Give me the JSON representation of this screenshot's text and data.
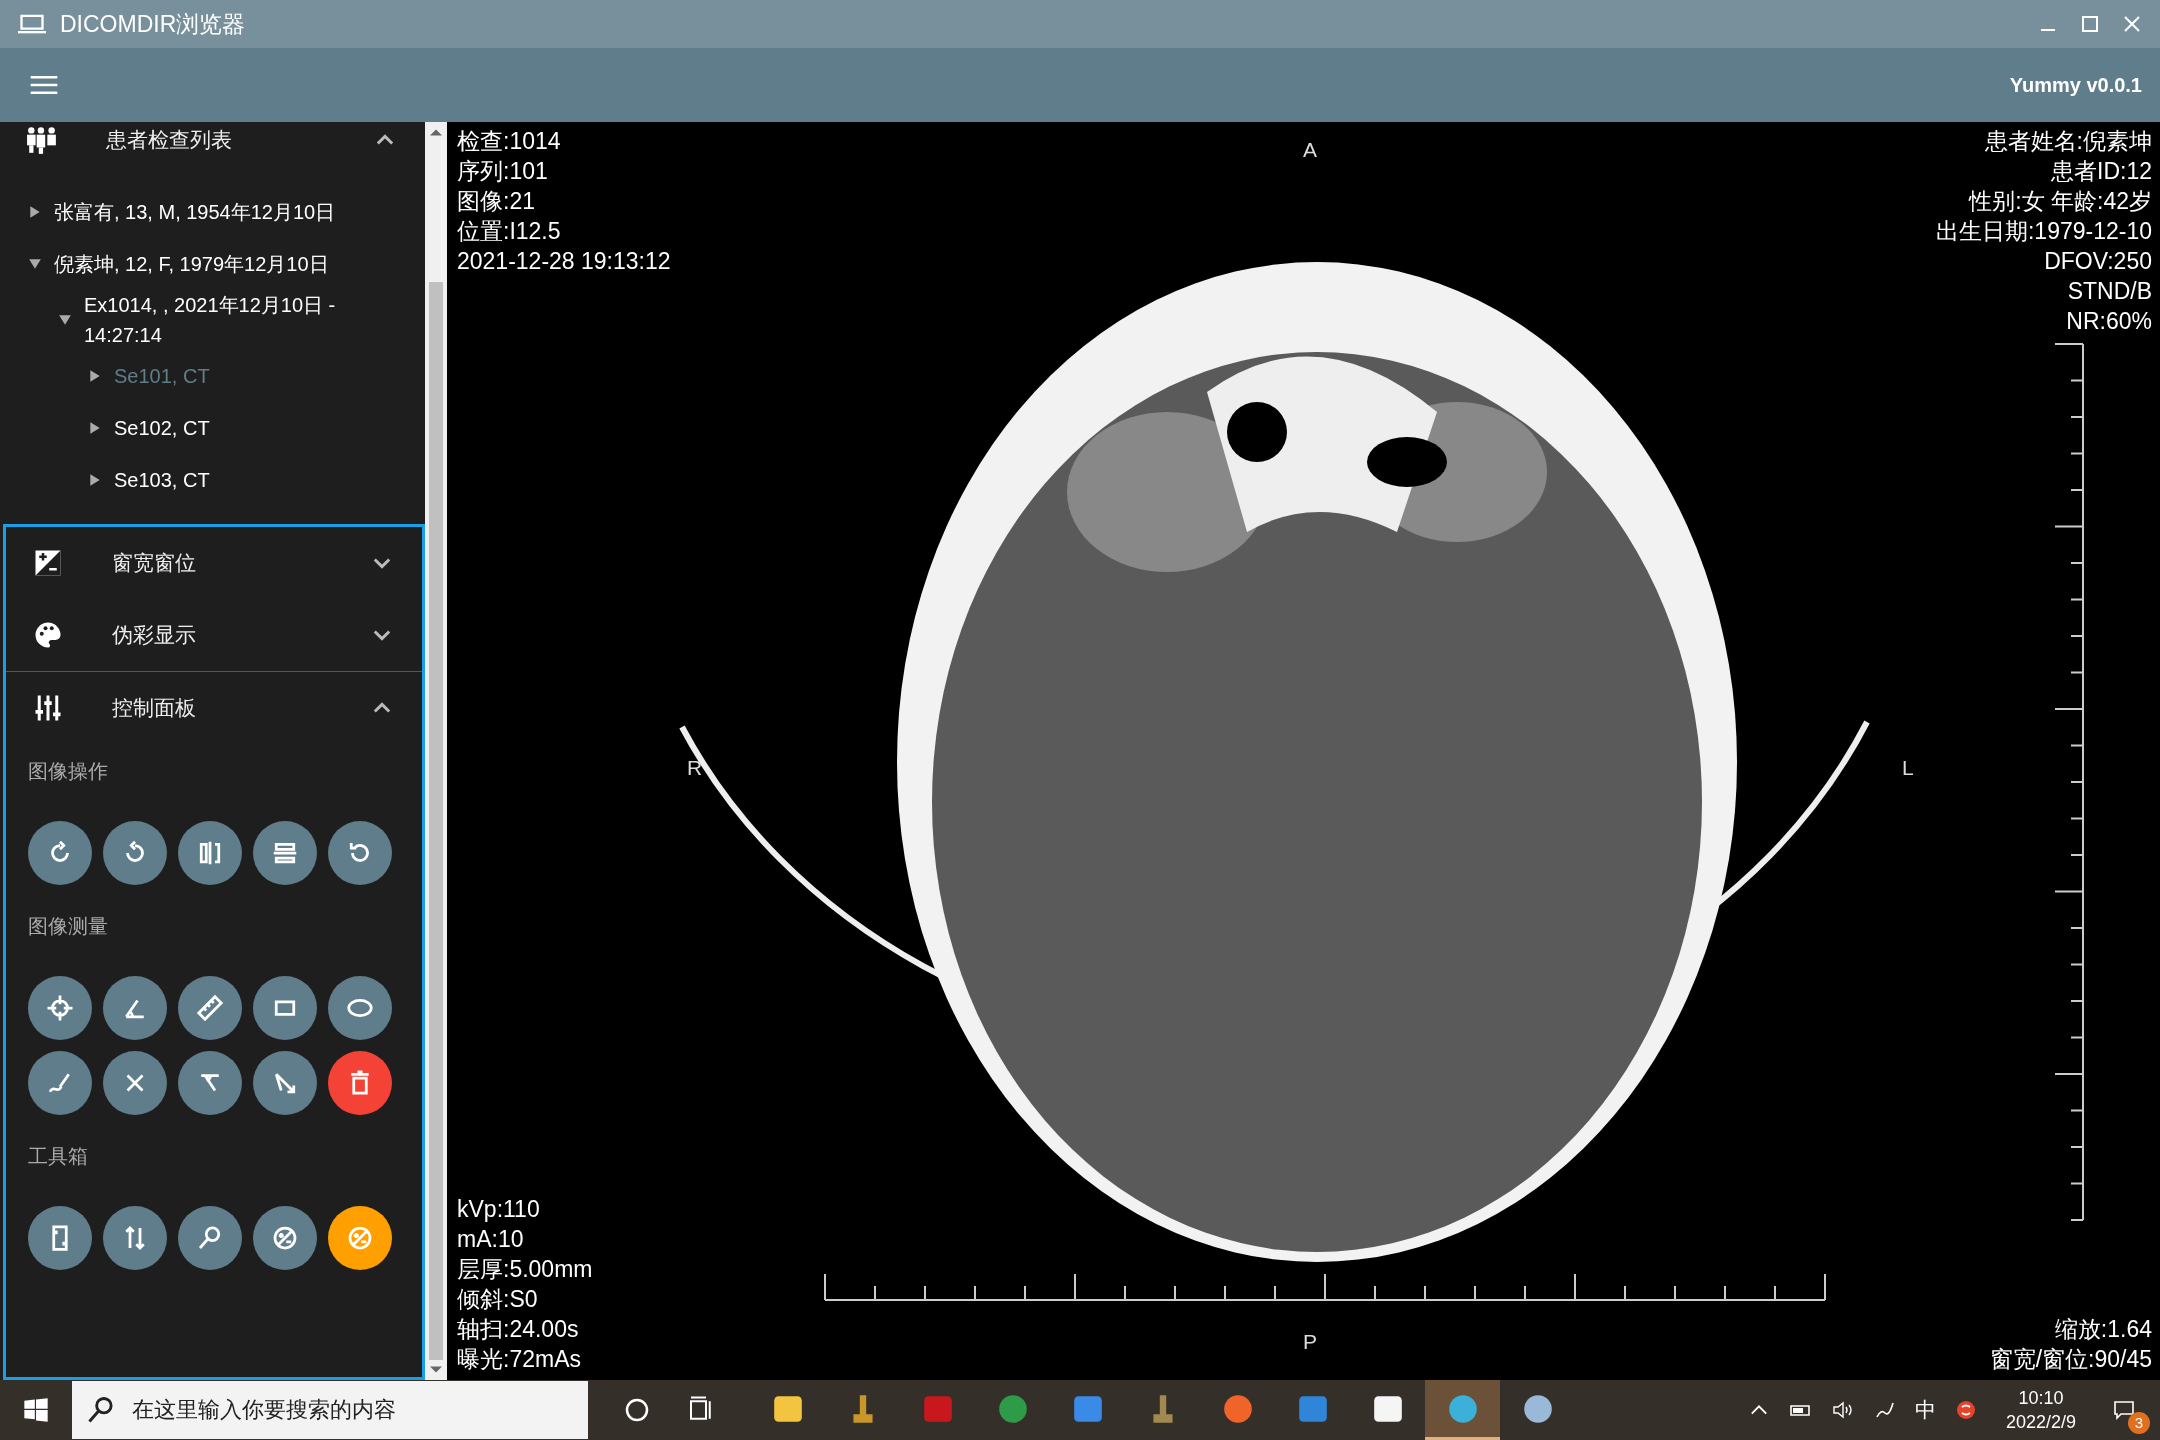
{
  "window": {
    "title": "DICOMDIR浏览器"
  },
  "app_bar": {
    "version": "Yummy v0.0.1"
  },
  "sidebar": {
    "patient_list": {
      "title": "患者检查列表",
      "expanded": true,
      "tree": [
        {
          "label": "张富有, 13, M, 1954年12月10日",
          "expanded": false,
          "selected": false
        },
        {
          "label": "倪素坤, 12, F, 1979年12月10日",
          "expanded": true,
          "selected": false,
          "children": [
            {
              "label": "Ex1014, , 2021年12月10日 - 14:27:14",
              "expanded": true,
              "selected": false,
              "children": [
                {
                  "label": "Se101, CT",
                  "expanded": false,
                  "selected": true
                },
                {
                  "label": "Se102, CT",
                  "expanded": false,
                  "selected": false
                },
                {
                  "label": "Se103, CT",
                  "expanded": false,
                  "selected": false
                }
              ]
            }
          ]
        }
      ]
    },
    "panels": [
      {
        "kind": "window-level",
        "title": "窗宽窗位",
        "expanded": false
      },
      {
        "kind": "pseudo-color",
        "title": "伪彩显示",
        "expanded": false
      },
      {
        "kind": "control",
        "title": "控制面板",
        "expanded": true
      }
    ],
    "tool_groups": [
      {
        "title": "图像操作",
        "tools": [
          {
            "kind": "rotate-cw",
            "selected": false
          },
          {
            "kind": "rotate-ccw",
            "selected": false
          },
          {
            "kind": "flip-h",
            "selected": false
          },
          {
            "kind": "flip-v",
            "selected": false
          },
          {
            "kind": "reset",
            "selected": false
          }
        ]
      },
      {
        "title": "图像测量",
        "tools": [
          {
            "kind": "crosshair",
            "selected": false
          },
          {
            "kind": "angle",
            "selected": false
          },
          {
            "kind": "ruler",
            "selected": false
          },
          {
            "kind": "rectangle",
            "selected": false
          },
          {
            "kind": "ellipse",
            "selected": false
          },
          {
            "kind": "freehand",
            "selected": false
          },
          {
            "kind": "cross",
            "selected": false
          },
          {
            "kind": "cobb",
            "selected": false
          },
          {
            "kind": "arrow-angle",
            "selected": false
          },
          {
            "kind": "delete",
            "selected": false
          }
        ]
      },
      {
        "title": "工具箱",
        "tools": [
          {
            "kind": "portrait",
            "selected": false
          },
          {
            "kind": "swap",
            "selected": false
          },
          {
            "kind": "zoom",
            "selected": false
          },
          {
            "kind": "contrast",
            "selected": false
          },
          {
            "kind": "contrast",
            "selected": true
          }
        ]
      }
    ]
  },
  "viewer": {
    "top_left": [
      "检查:1014",
      "序列:101",
      "图像:21",
      "位置:I12.5",
      "2021-12-28 19:13:12"
    ],
    "top_right": [
      "患者姓名:倪素坤",
      "患者ID:12",
      "性别:女 年龄:42岁",
      "出生日期:1979-12-10",
      "DFOV:250",
      "STND/B",
      "NR:60%"
    ],
    "bottom_left": [
      "kVp:110",
      "mA:10",
      "层厚:5.00mm",
      "倾斜:S0",
      "轴扫:24.00s",
      "曝光:72mAs"
    ],
    "bottom_right": [
      "缩放:1.64",
      "窗宽/窗位:90/45"
    ],
    "markers": {
      "top": "A",
      "bottom": "P",
      "left": "R",
      "right": "L"
    }
  },
  "taskbar": {
    "search": {
      "placeholder": "在这里输入你要搜索的内容"
    },
    "apps": [
      {
        "kind": "folder",
        "selected": false
      },
      {
        "kind": "tool",
        "selected": false
      },
      {
        "kind": "ftp",
        "selected": false
      },
      {
        "kind": "browser",
        "selected": false
      },
      {
        "kind": "bird",
        "selected": false
      },
      {
        "kind": "microscope",
        "selected": false
      },
      {
        "kind": "brush",
        "selected": false
      },
      {
        "kind": "code",
        "selected": false
      },
      {
        "kind": "text",
        "selected": false
      },
      {
        "kind": "viewer",
        "selected": true
      },
      {
        "kind": "paint",
        "selected": false
      }
    ],
    "ime": "中",
    "time": "10:10",
    "date": "2022/2/9",
    "notifications": "3"
  }
}
